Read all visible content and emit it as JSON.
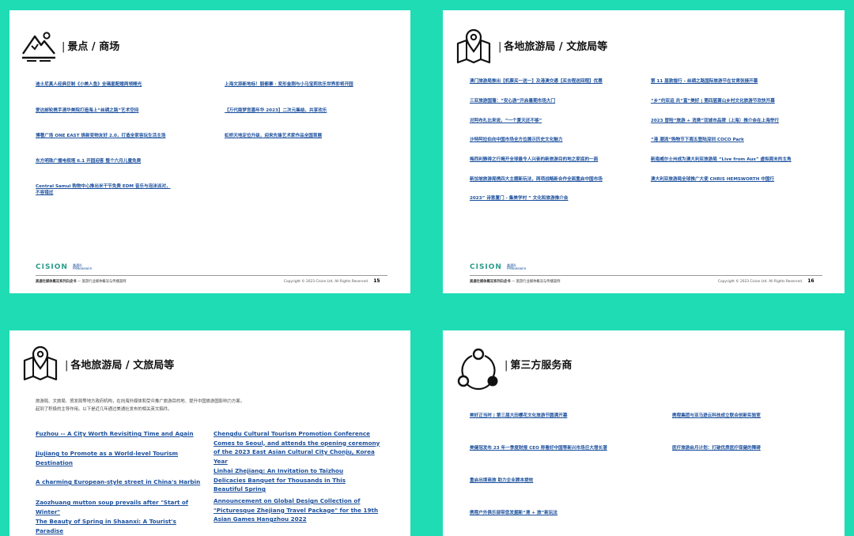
{
  "slides": [
    {
      "title": "景点 / 商场",
      "icon": "mountain-icon",
      "links_left": [
        "迪士尼真人经典巨制《小美人鱼》全璃星配婚两领睡光",
        "爱达邮轮携手清华美院打造海上“丝绸之路”艺术空间",
        "博著广场 ONE EAST 焕新变物友好 2.0，打造全家容玩生活主场",
        "东方明珠广播电视塔 6.1 开园迎客 整个六月儿童免费",
        "Central Samui 购物中心推出米干节免费 EDM 音乐与泡沫派对，\n不容错过"
      ],
      "links_right": [
        "上海文添新地标！毅都寨 · 变形金刚与小马宝莉欢乐世界即将开园",
        "【万代南梦宫嘉年华 2023】二次元集结，共享欢乐",
        "虹桥天地定位升级，迎来先锋艺术家作品全国首展"
      ],
      "footer_left_bold": "美通社媒体概况系列白皮书",
      "footer_left_rest": " — 旅游行业媒体概况与传播案例",
      "footer_right": "Copyright © 2023 Cision Ltd. All Rights Reserved.",
      "page": "15"
    },
    {
      "title": "各地旅游局 / 文旅局等",
      "icon": "map-pin-icon",
      "links_left": [
        "澳门旅游局推出【机票买一送一】及港澳交通【买去程送回程】优惠",
        "三亚旅游国藩：“安心游”开启暑期市场大门",
        "对阿布扎比来说，“一个夏天还不够”",
        "沙特阿拉伯向中国市场全方位展示历史文化魅力",
        "梅西利雅得之行揭开全球最令人兴奋的新旅游目的地之家底的一面",
        "新加坡旅游局携四大主题新玩法，两项战略新合作全面重启中国市场",
        "2023” 诗意厦门 - 集美学村 ” 文化和旅游推介会"
      ],
      "links_right": [
        "第 11 届敦煌行 - 丝绸之路国际旅游节在甘肃张掖开幕",
        "“乡”约亚运 共“富”美好 | 第四届萧山乡村文化旅游节欢快开幕",
        "2023 冒险“旅游 + 消费”双城市品牌（上海）推介会在上海举行",
        "“港   潮流”购物节下周五登陆深圳 COCO Park",
        "新南威尔士州成为澳大利亚旅游局 “Live from Aus” 虚拟周末的主角",
        "澳大利亚旅游局全球推广大使 CHRIS HEMSWORTH 中国行"
      ],
      "footer_left_bold": "美通社媒体概况系列白皮书",
      "footer_left_rest": " — 旅游行业媒体概况与传播案例",
      "footer_right": "Copyright © 2023 Cision Ltd. All Rights Reserved.",
      "page": "16"
    },
    {
      "title": "各地旅游局 / 文旅局等",
      "icon": "map-pin-icon",
      "intro": "旅游局、文旅局、贸发局等地方政府机构，在向海外媒体和受众推广旅游目的地、提升中国旅游国影响力方面，\n起到了积极的主导作用。以下是近几年通过美通社发布的相关英文稿件。",
      "links_left": [
        "Fuzhou -- A City Worth Revisiting Time and Again",
        "Jiujiang to Promote as a World-level Tourism Destination",
        "A charming European-style street in China's Harbin",
        "Zaozhuang mutton soup prevails after \"Start of Winter\"",
        "The Beauty of Spring in Shaanxi: A Tourist's Paradise"
      ],
      "links_right": [
        "Chengdu Cultural Tourism Promotion Conference Comes to Seoul, and attends the opening ceremony of the 2023 East Asian Cultural City Chonju, Korea Year",
        "Linhai Zhejiang: An Invitation to Taizhou Delicacies Banquet for Thousands in This Beautiful Spring",
        "Announcement on Global Design Collection of \"Picturesque Zhejiang Travel Package\" for the 19th Asian Games Hangzhou 2022"
      ]
    },
    {
      "title": "第三方服务商",
      "icon": "network-cycle-icon",
      "links_left": [
        "美好正当时 | 第三届大田樱花文化旅游节圆满开幕",
        "美健冠发布 23 年一季度财报 CEO 称看好中国等新兴市场巨大增长潜",
        "重启出境商旅 助力企业顾本提效",
        "携程户外俱乐部带您发掘新“滑 + 旅”新玩法"
      ],
      "links_right": [
        "携程集团与亚马逊云科技成立联合创新实验室",
        "医疗旅游启月计划：打破优质医疗保健的障碍"
      ]
    }
  ],
  "colors": {
    "background": "#1fdcb5",
    "link": "#1b4f9c",
    "logo": "#2a9c8a"
  },
  "logo_text": "CISION",
  "logo_sub": "美通社\nPRNewswire"
}
